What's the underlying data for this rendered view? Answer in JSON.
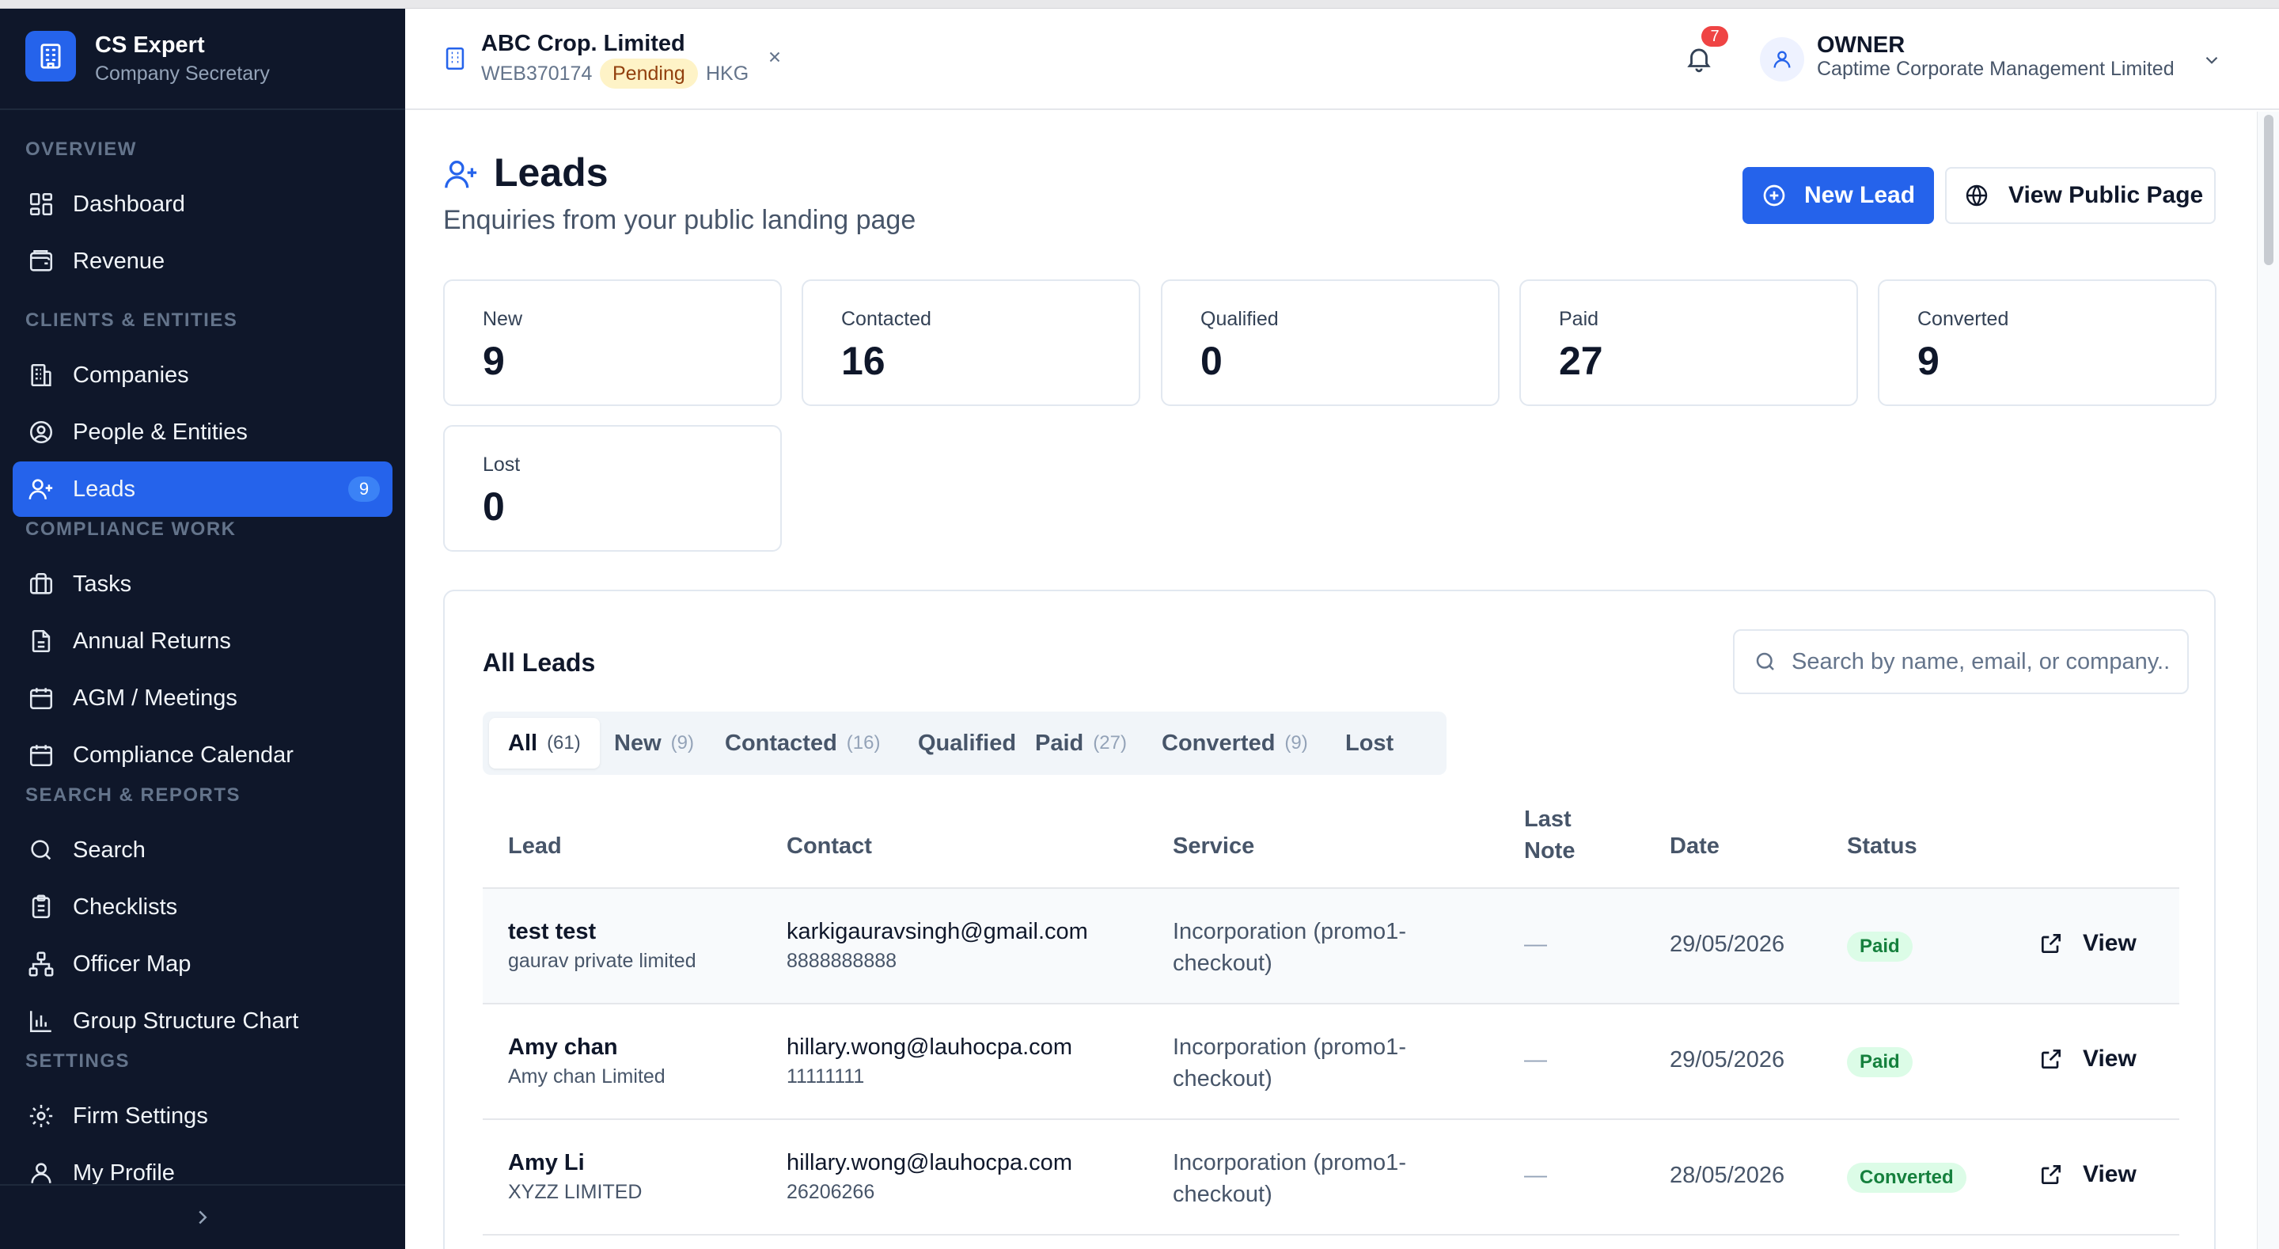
{
  "brand": {
    "name": "CS Expert",
    "subtitle": "Company Secretary"
  },
  "sidebar": {
    "sections": {
      "overview": "OVERVIEW",
      "clients": "CLIENTS & ENTITIES",
      "compliance": "COMPLIANCE WORK",
      "search": "SEARCH & REPORTS",
      "settings": "SETTINGS"
    },
    "items": {
      "dashboard": "Dashboard",
      "revenue": "Revenue",
      "companies": "Companies",
      "people": "People & Entities",
      "leads": "Leads",
      "leads_badge": "9",
      "tasks": "Tasks",
      "annual_returns": "Annual Returns",
      "agm": "AGM / Meetings",
      "calendar": "Compliance Calendar",
      "search": "Search",
      "checklists": "Checklists",
      "officer_map": "Officer Map",
      "group_chart": "Group Structure Chart",
      "firm_settings": "Firm Settings",
      "my_profile": "My Profile"
    },
    "active": "leads"
  },
  "header": {
    "company_name": "ABC Crop. Limited",
    "company_id": "WEB370174",
    "company_status": "Pending",
    "company_country": "HKG",
    "notifications_count": "7",
    "user_role": "OWNER",
    "user_org": "Captime Corporate Management Limited"
  },
  "page": {
    "title": "Leads",
    "subtitle": "Enquiries from your public landing page",
    "new_lead_label": "New Lead",
    "view_public_label": "View Public Page"
  },
  "stats": [
    {
      "label": "New",
      "value": "9"
    },
    {
      "label": "Contacted",
      "value": "16"
    },
    {
      "label": "Qualified",
      "value": "0"
    },
    {
      "label": "Paid",
      "value": "27"
    },
    {
      "label": "Converted",
      "value": "9"
    },
    {
      "label": "Lost",
      "value": "0"
    }
  ],
  "all_leads": {
    "title": "All Leads",
    "search_placeholder": "Search by name, email, or company...",
    "tabs": [
      {
        "label": "All",
        "count": "(61)"
      },
      {
        "label": "New",
        "count": "(9)"
      },
      {
        "label": "Contacted",
        "count": "(16)"
      },
      {
        "label": "Qualified",
        "count": ""
      },
      {
        "label": "Paid",
        "count": "(27)"
      },
      {
        "label": "Converted",
        "count": "(9)"
      },
      {
        "label": "Lost",
        "count": ""
      }
    ],
    "active_tab": "All",
    "columns": {
      "lead": "Lead",
      "contact": "Contact",
      "service": "Service",
      "last_note_1": "Last",
      "last_note_2": "Note",
      "date": "Date",
      "status": "Status"
    },
    "rows": [
      {
        "name": "test test",
        "company": "gaurav private limited",
        "email": "karkigauravsingh@gmail.com",
        "phone": "8888888888",
        "service_1": "Incorporation (promo1-",
        "service_2": "checkout)",
        "last_note": "—",
        "date": "29/05/2026",
        "status": "Paid",
        "action": "View"
      },
      {
        "name": "Amy chan",
        "company": "Amy chan Limited",
        "email": "hillary.wong@lauhocpa.com",
        "phone": "11111111",
        "service_1": "Incorporation (promo1-",
        "service_2": "checkout)",
        "last_note": "—",
        "date": "29/05/2026",
        "status": "Paid",
        "action": "View"
      },
      {
        "name": "Amy Li",
        "company": "XYZZ LIMITED",
        "email": "hillary.wong@lauhocpa.com",
        "phone": "26206266",
        "service_1": "Incorporation (promo1-",
        "service_2": "checkout)",
        "last_note": "—",
        "date": "28/05/2026",
        "status": "Converted",
        "action": "View"
      }
    ]
  },
  "colors": {
    "primary": "#2563eb",
    "sidebar_bg": "#0f172a",
    "badge_red": "#ef4444",
    "status_green_bg": "#dcfce7",
    "status_green_text": "#15803d",
    "pending_bg": "#fef3c7"
  }
}
